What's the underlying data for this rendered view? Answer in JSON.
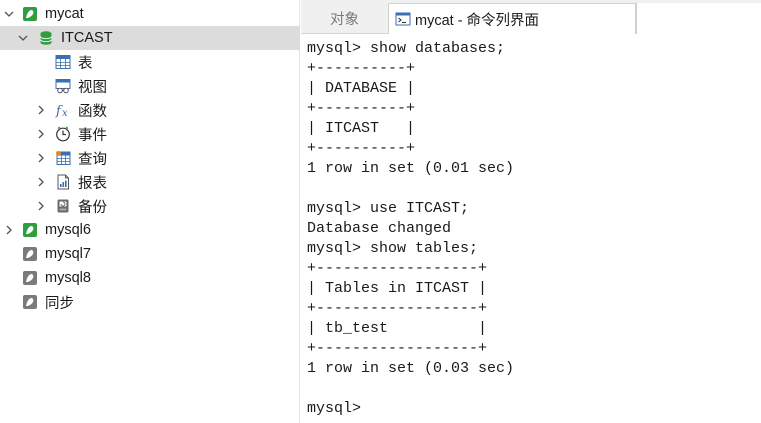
{
  "sidebar": {
    "items": [
      {
        "label": "mycat",
        "expanded": true,
        "icon": "dolphin-green-icon"
      },
      {
        "label": "ITCAST",
        "expanded": true,
        "selected": true,
        "icon": "database-icon"
      },
      {
        "label": "表",
        "icon": "table-icon"
      },
      {
        "label": "视图",
        "icon": "view-icon"
      },
      {
        "label": "函数",
        "icon": "function-icon"
      },
      {
        "label": "事件",
        "icon": "event-clock-icon"
      },
      {
        "label": "查询",
        "icon": "query-icon"
      },
      {
        "label": "报表",
        "icon": "report-icon"
      },
      {
        "label": "备份",
        "icon": "backup-icon"
      },
      {
        "label": "mysql6",
        "expanded": false,
        "icon": "dolphin-green-icon"
      },
      {
        "label": "mysql7",
        "icon": "dolphin-gray-icon"
      },
      {
        "label": "mysql8",
        "icon": "dolphin-gray-icon"
      },
      {
        "label": "同步",
        "icon": "dolphin-gray-icon"
      }
    ]
  },
  "tabs": {
    "objects": "对象",
    "console": "mycat - 命令列界面"
  },
  "console": {
    "lines": [
      "mysql> show databases;",
      "+----------+",
      "| DATABASE |",
      "+----------+",
      "| ITCAST   |",
      "+----------+",
      "1 row in set (0.01 sec)",
      "",
      "mysql> use ITCAST;",
      "Database changed",
      "mysql> show tables;",
      "+------------------+",
      "| Tables in ITCAST |",
      "+------------------+",
      "| tb_test          |",
      "+------------------+",
      "1 row in set (0.03 sec)",
      "",
      "mysql>"
    ]
  },
  "colors": {
    "selected_row": "#dcdcdc",
    "dolphin_green": "#2e9e3f",
    "database_green": "#2e9e3f",
    "tab_bar": "#f0f0f0"
  }
}
